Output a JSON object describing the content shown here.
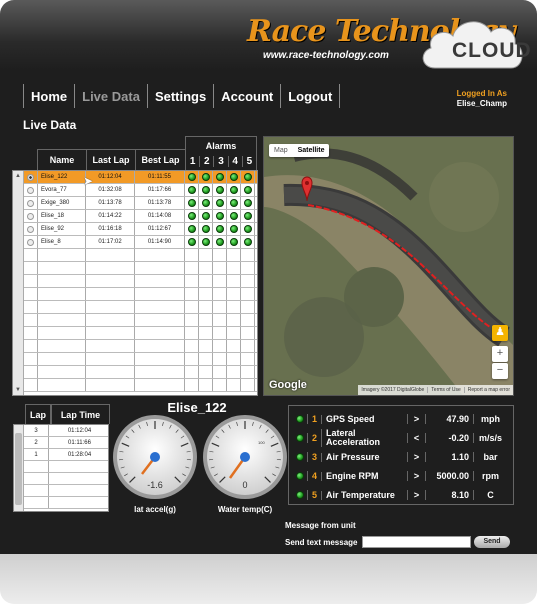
{
  "brand": {
    "logo_text": "Race Technology",
    "url_text": "www.race-technology.com",
    "cloud_text": "CLOUD"
  },
  "nav": {
    "items": [
      {
        "label": "Home"
      },
      {
        "label": "Live Data"
      },
      {
        "label": "Settings"
      },
      {
        "label": "Account"
      },
      {
        "label": "Logout"
      }
    ]
  },
  "login": {
    "label": "Logged In As",
    "user": "Elise_Champ"
  },
  "page_title": "Live Data",
  "drivers": {
    "headers": {
      "name": "Name",
      "last_lap": "Last Lap",
      "best_lap": "Best Lap",
      "alarms": "Alarms",
      "alarm_nums": [
        "1",
        "2",
        "3",
        "4",
        "5"
      ]
    },
    "rows": [
      {
        "name": "Elise_122",
        "last": "01:12:04",
        "best": "01:11:55"
      },
      {
        "name": "Evora_77",
        "last": "01:32:08",
        "best": "01:17:66"
      },
      {
        "name": "Exige_380",
        "last": "01:13:78",
        "best": "01:13:78"
      },
      {
        "name": "Elise_18",
        "last": "01:14:22",
        "best": "01:14:08"
      },
      {
        "name": "Elise_92",
        "last": "01:16:18",
        "best": "01:12:67"
      },
      {
        "name": "Elise_8",
        "last": "01:17:02",
        "best": "01:14:90"
      }
    ]
  },
  "map": {
    "toggle_map": "Map",
    "toggle_satellite": "Satellite",
    "google": "Google",
    "attribution": [
      "Imagery ©2017 DigitalGlobe",
      "Terms of Use",
      "Report a map error"
    ],
    "zoom_in": "+",
    "zoom_out": "−"
  },
  "laps": {
    "headers": {
      "lap": "Lap",
      "time": "Lap Time"
    },
    "rows": [
      {
        "lap": "3",
        "time": "01:12:04"
      },
      {
        "lap": "2",
        "time": "01:11:66"
      },
      {
        "lap": "1",
        "time": "01:28:04"
      }
    ]
  },
  "selected_car": "Elise_122",
  "gauges": [
    {
      "label": "lat accel(g)",
      "value": "-1.6"
    },
    {
      "label": "Water temp(C)",
      "value": "0",
      "unit_mark": "100"
    }
  ],
  "channels": [
    {
      "num": "1",
      "name": "GPS Speed",
      "op": ">",
      "value": "47.90",
      "unit": "mph"
    },
    {
      "num": "2",
      "name": "Lateral Acceleration",
      "op": "<",
      "value": "-0.20",
      "unit": "m/s/s"
    },
    {
      "num": "3",
      "name": "Air Pressure",
      "op": ">",
      "value": "1.10",
      "unit": "bar"
    },
    {
      "num": "4",
      "name": "Engine RPM",
      "op": ">",
      "value": "5000.00",
      "unit": "rpm"
    },
    {
      "num": "5",
      "name": "Air Temperature",
      "op": ">",
      "value": "8.10",
      "unit": "C"
    }
  ],
  "messages": {
    "from_unit": "Message from unit",
    "send_label": "Send text message",
    "send_button": "Send"
  },
  "colors": {
    "accent": "#f0a020",
    "selected_row": "#f29a26",
    "background": "#1e1e1e",
    "track_line": "#e02020"
  }
}
